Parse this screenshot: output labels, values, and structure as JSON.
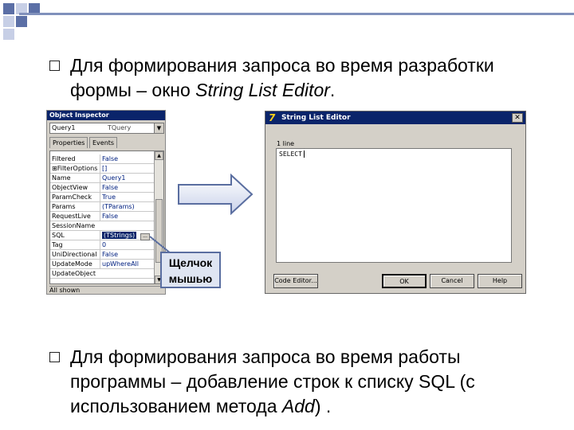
{
  "bullets": {
    "first_line1": "Для формирования запроса во время разработки",
    "first_line2_prefix": "формы – окно ",
    "first_line2_italic": "String List Editor",
    "first_line2_suffix": ".",
    "second_line1": "Для формирования запроса во время работы",
    "second_line2": "программы – добавление строк к списку SQL (с",
    "second_line3_prefix": "использованием метода ",
    "second_line3_italic": "Add",
    "second_line3_suffix": ") ."
  },
  "object_inspector": {
    "title": "Object Inspector",
    "component": "Query1",
    "component_type": "TQuery",
    "tabs": [
      "Properties",
      "Events"
    ],
    "rows": [
      {
        "name": "Filtered",
        "value": "False"
      },
      {
        "name": "⊞FilterOptions",
        "value": "[]"
      },
      {
        "name": "Name",
        "value": "Query1"
      },
      {
        "name": "ObjectView",
        "value": "False"
      },
      {
        "name": "ParamCheck",
        "value": "True"
      },
      {
        "name": "Params",
        "value": "(TParams)"
      },
      {
        "name": "RequestLive",
        "value": "False"
      },
      {
        "name": "SessionName",
        "value": ""
      },
      {
        "name": "SQL",
        "value": "(TStrings)"
      },
      {
        "name": "Tag",
        "value": "0"
      },
      {
        "name": "UniDirectional",
        "value": "False"
      },
      {
        "name": "UpdateMode",
        "value": "upWhereAll"
      },
      {
        "name": "UpdateObject",
        "value": ""
      }
    ],
    "status": "All shown",
    "ellipsis": "..."
  },
  "callout": {
    "line1": "Щелчок",
    "line2": "мышью"
  },
  "string_list_editor": {
    "title": "String List Editor",
    "lines_label": "1 line",
    "memo_text": "SELECT",
    "buttons": {
      "code_editor": "Code Editor...",
      "ok": "OK",
      "cancel": "Cancel",
      "help": "Help"
    }
  },
  "colors": {
    "accent": "#5b6fa6",
    "titlebar": "#0a246a",
    "callout_fill": "#dfe5f2"
  }
}
